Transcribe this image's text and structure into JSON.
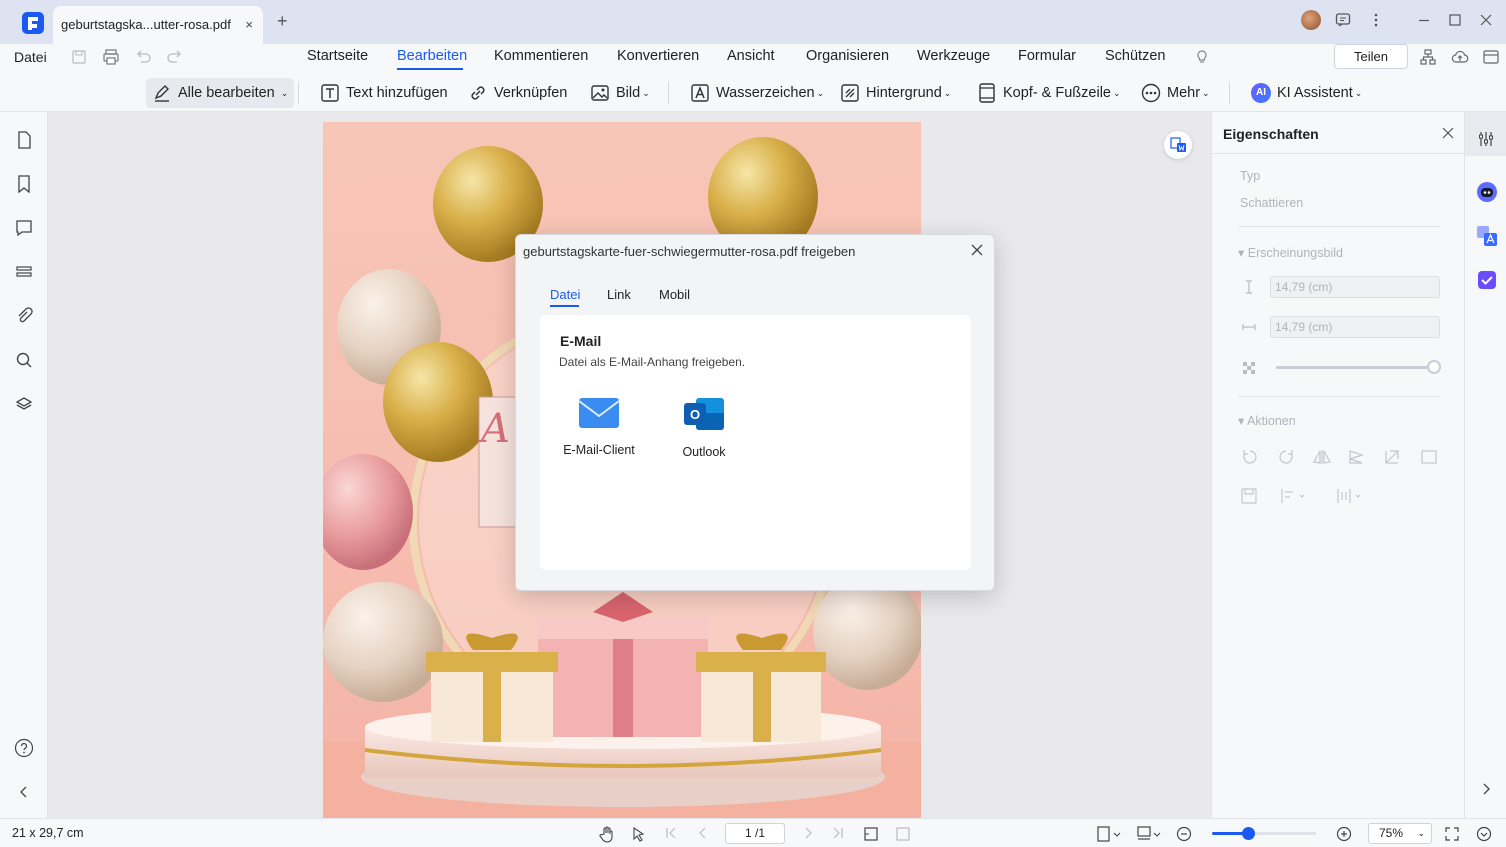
{
  "tab": {
    "title": "geburtstagska...utter-rosa.pdf",
    "close": "×",
    "new": "+"
  },
  "menu": {
    "file": "Datei",
    "items": [
      "Startseite",
      "Bearbeiten",
      "Kommentieren",
      "Konvertieren",
      "Ansicht",
      "Organisieren",
      "Werkzeuge",
      "Formular",
      "Schützen"
    ],
    "share": "Teilen"
  },
  "toolbar": {
    "edit_all": "Alle bearbeiten",
    "add_text": "Text hinzufügen",
    "link": "Verknüpfen",
    "image": "Bild",
    "watermark": "Wasserzeichen",
    "background": "Hintergrund",
    "header_footer": "Kopf- & Fußzeile",
    "more": "Mehr",
    "ai": "KI Assistent",
    "ai_badge": "AI"
  },
  "properties": {
    "title": "Eigenschaften",
    "type": "Typ",
    "shading": "Schattieren",
    "appearance": "Erscheinungsbild",
    "height": "14,79 (cm)",
    "width": "14,79 (cm)",
    "opacity": 1.0,
    "actions": "Aktionen"
  },
  "dialog": {
    "title": "geburtstagskarte-fuer-schwiegermutter-rosa.pdf freigeben",
    "tabs": [
      "Datei",
      "Link",
      "Mobil"
    ],
    "active_tab": "Datei",
    "card_title": "E-Mail",
    "card_desc": "Datei als E-Mail-Anhang freigeben.",
    "options": [
      "E-Mail-Client",
      "Outlook"
    ]
  },
  "status": {
    "dimensions": "21 x 29,7 cm",
    "page": "1 /1",
    "zoom": "75%",
    "zoom_level": 0.35
  },
  "colors": {
    "accent": "#1a5af0",
    "page_bg": "#f7c6b7",
    "gold": "#d9b04a"
  }
}
